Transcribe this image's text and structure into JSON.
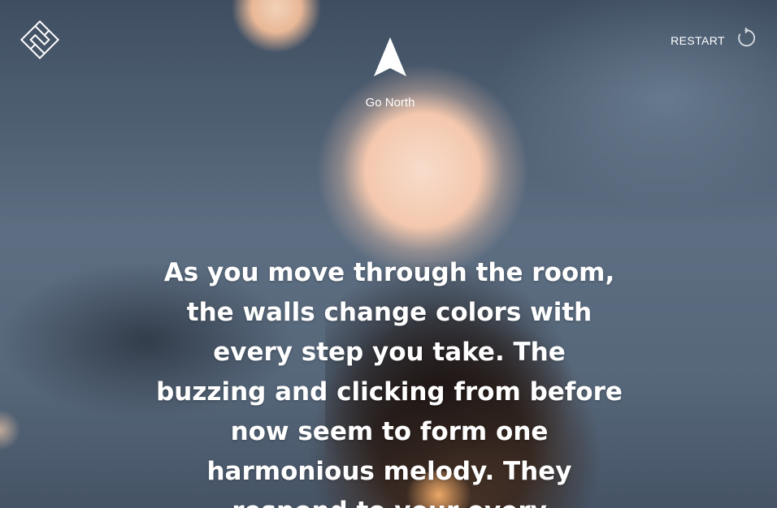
{
  "header": {
    "logo_icon": "maze-logo-icon",
    "compass": {
      "icon": "north-arrow-icon",
      "label": "Go North"
    },
    "restart": {
      "label": "RESTART",
      "icon": "restart-icon"
    }
  },
  "story": {
    "text": "As you move through the room, the walls change colors with every step you take. The buzzing and clicking from before now seem to form one harmonious melody. They respond to your every"
  },
  "colors": {
    "text": "#ffffff",
    "background_overlay": "#4a5a6c"
  }
}
